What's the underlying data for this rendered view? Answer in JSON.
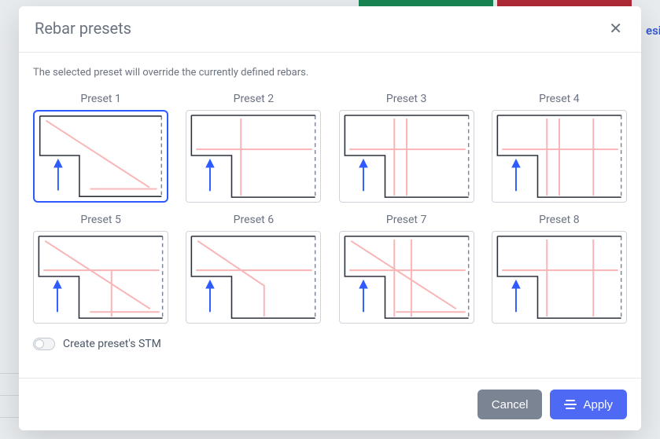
{
  "header": {
    "title": "Rebar presets"
  },
  "info": "The selected preset will override the currently defined rebars.",
  "presets": [
    {
      "label": "Preset 1",
      "selected": true
    },
    {
      "label": "Preset 2",
      "selected": false
    },
    {
      "label": "Preset 3",
      "selected": false
    },
    {
      "label": "Preset 4",
      "selected": false
    },
    {
      "label": "Preset 5",
      "selected": false
    },
    {
      "label": "Preset 6",
      "selected": false
    },
    {
      "label": "Preset 7",
      "selected": false
    },
    {
      "label": "Preset 8",
      "selected": false
    }
  ],
  "toggle": {
    "label": "Create preset's STM",
    "value": false
  },
  "footer": {
    "cancel": "Cancel",
    "apply": "Apply"
  },
  "backdrop": {
    "link_snippet": "esi"
  },
  "colors": {
    "accent": "#4e6af5",
    "rebar": "#f9b5b5",
    "outline": "#2b303b",
    "arrow": "#2d5bff"
  }
}
